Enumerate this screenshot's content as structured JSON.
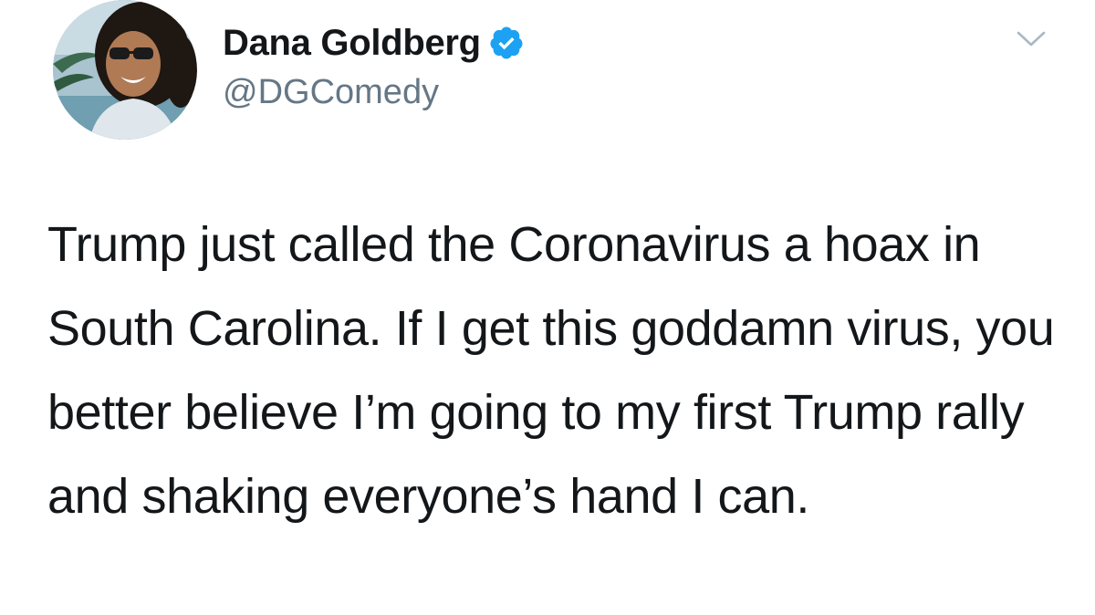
{
  "author": {
    "display_name": "Dana Goldberg",
    "handle": "@DGComedy",
    "verified": true,
    "avatar_icon": "profile-photo"
  },
  "menu": {
    "icon": "chevron-down-icon"
  },
  "tweet": {
    "text": "Trump just called the Coronavirus a hoax in South Carolina. If I get this goddamn virus, you better believe I’m going to my first Trump rally and shaking everyone’s hand I can."
  },
  "colors": {
    "verified_badge": "#1da1f2",
    "handle_gray": "#657786",
    "text": "#14171a",
    "caret_gray": "#aab8c2"
  }
}
